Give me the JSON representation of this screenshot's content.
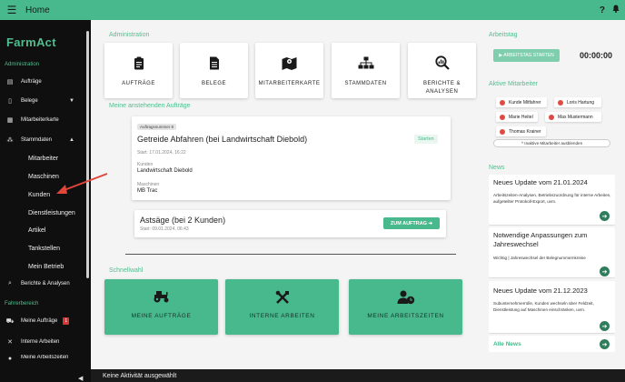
{
  "topbar": {
    "title": "Home",
    "help": "?"
  },
  "sidebar": {
    "logo": "FarmAct",
    "section_admin": "Administration",
    "section_driver": "Fahrerbereich",
    "items": [
      {
        "label": "Aufträge"
      },
      {
        "label": "Belege"
      },
      {
        "label": "Mitarbeiterkarte"
      },
      {
        "label": "Stammdaten"
      },
      {
        "label": "Mitarbeiter"
      },
      {
        "label": "Maschinen"
      },
      {
        "label": "Kunden"
      },
      {
        "label": "Dienstleistungen"
      },
      {
        "label": "Artikel"
      },
      {
        "label": "Tankstellen"
      },
      {
        "label": "Mein Betrieb"
      },
      {
        "label": "Berichte & Analysen"
      },
      {
        "label": "Meine Aufträge",
        "badge": "1"
      },
      {
        "label": "Interne Arbeiten"
      },
      {
        "label": "Meine Arbeitszeiten"
      }
    ]
  },
  "main": {
    "admin_title": "Administration",
    "tiles": [
      {
        "label": "AUFTRÄGE",
        "icon": "clipboard-icon"
      },
      {
        "label": "BELEGE",
        "icon": "document-icon"
      },
      {
        "label": "MITARBEITERKARTE",
        "icon": "map-icon"
      },
      {
        "label": "STAMMDATEN",
        "icon": "hierarchy-icon"
      },
      {
        "label": "BERICHTE & ANALYSEN",
        "icon": "search-chart-icon"
      }
    ],
    "orders_title": "Meine anstehenden Aufträge",
    "order1": {
      "pill": "Auftragsnummer 8",
      "title": "Getreide Abfahren (bei Landwirtschaft Diebold)",
      "start": "Start: 17.01.2024, 16:22",
      "status": "Starten",
      "customer_label": "Kunden",
      "customer": "Landwirtschaft Diebold",
      "machine_label": "Maschinen",
      "machine": "MB Trac"
    },
    "order2": {
      "title": "Astsäge (bei 2 Kunden)",
      "start": "Start: 09.01.2024, 06:43",
      "button": "ZUM AUFTRAG ➔"
    },
    "quick_title": "Schnellwahl",
    "quick": [
      {
        "label": "MEINE AUFTRÄGE",
        "icon": "tractor-icon"
      },
      {
        "label": "INTERNE ARBEITEN",
        "icon": "tools-icon"
      },
      {
        "label": "MEINE ARBEITSZEITEN",
        "icon": "user-clock-icon"
      }
    ]
  },
  "right": {
    "workday_title": "Arbeitstag",
    "workday_button": "▶ ARBEITSTAG STARTEN",
    "timer": "00:00:00",
    "active_title": "Aktive Mitarbeiter",
    "employees": [
      "Kunde Mitfahrer",
      "Loris Hartung",
      "Marie Heitel",
      "Max Mustermann",
      "Thomas Krainer"
    ],
    "hide_inactive": "^ Inaktive Mitarbeiter ausblenden",
    "news_title": "News",
    "news": [
      {
        "title": "Neues Update vom 21.01.2024",
        "text": "Arbeitszeiten-Analysen, Betriebszuordnung für interne Arbeiten, aufgeteilter Protokoll-Export, uvm."
      },
      {
        "title": "Notwendige Anpassungen zum Jahreswechsel",
        "text": "Wichtig | Jahreswechsel der Belegnummernkreise"
      },
      {
        "title": "Neues Update vom 21.12.2023",
        "text": "Subunternehmerrolle, Kunden wechseln über Feldzeit, Dienstleistung auf Maschinen einschränken, uvm."
      }
    ],
    "all_news": "Alle News"
  },
  "status": {
    "text": "Keine Aktivität ausgewählt"
  },
  "colors": {
    "accent": "#48b98c",
    "sidebar": "#0f0f0f",
    "arrow": "#e0463a"
  }
}
